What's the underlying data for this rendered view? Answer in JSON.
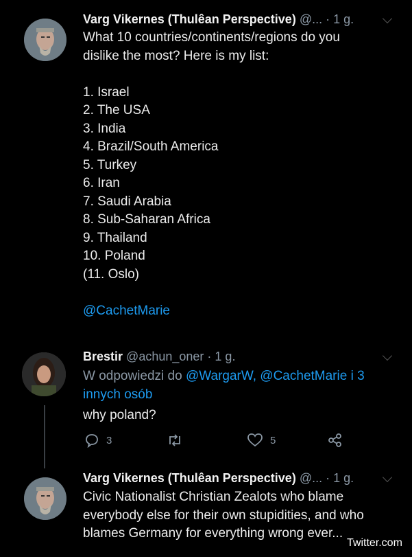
{
  "tweet1": {
    "name": "Varg Vikernes (Thulêan Perspective)",
    "handle": "@...",
    "time": "· 1 g.",
    "lines": [
      "What 10 countries/continents/regions do you",
      "dislike the most? Here is my list:",
      "",
      "1. Israel",
      "2. The USA",
      "3. India",
      "4. Brazil/South America",
      "5. Turkey",
      "6. Iran",
      "7. Saudi Arabia",
      "8. Sub-Saharan Africa",
      "9. Thailand",
      "10. Poland",
      "(11. Oslo)",
      ""
    ],
    "mention": "@CachetMarie"
  },
  "reply1": {
    "name": "Brestir",
    "handle": "@achun_oner",
    "time": "· 1 g.",
    "reply_prefix": "W odpowiedzi do",
    "reply_to": "@WargarW, @CachetMarie i 3",
    "reply_more": "innych osób",
    "text": "why poland?",
    "replies_count": "3",
    "likes_count": "5"
  },
  "tweet2": {
    "name": "Varg Vikernes (Thulêan Perspective)",
    "handle": "@...",
    "time": "· 1 g.",
    "lines": [
      "Civic Nationalist Christian Zealots who blame",
      "everybody else for their own stupidities, and who",
      "blames Germany for everything wrong ever..."
    ]
  },
  "watermark": "Twitter.com",
  "icons": [
    "comment-icon",
    "retweet-icon",
    "heart-icon",
    "share-icon",
    "chevron-down-icon"
  ]
}
